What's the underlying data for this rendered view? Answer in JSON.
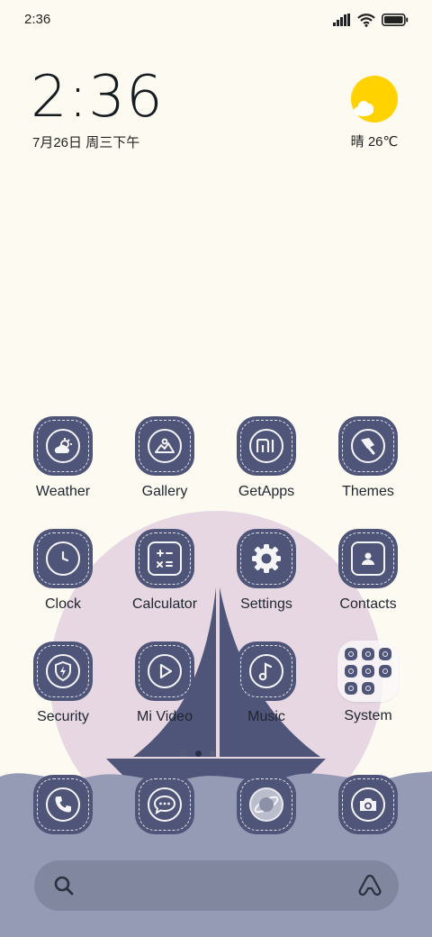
{
  "status_bar": {
    "time": "2:36"
  },
  "clock_widget": {
    "time": "2:36",
    "date": "7月26日 周三下午"
  },
  "weather_widget": {
    "condition": "晴",
    "temperature": "26℃"
  },
  "apps": [
    {
      "name": "weather",
      "label": "Weather"
    },
    {
      "name": "gallery",
      "label": "Gallery"
    },
    {
      "name": "getapps",
      "label": "GetApps"
    },
    {
      "name": "themes",
      "label": "Themes"
    },
    {
      "name": "clock",
      "label": "Clock"
    },
    {
      "name": "calculator",
      "label": "Calculator"
    },
    {
      "name": "settings",
      "label": "Settings"
    },
    {
      "name": "contacts",
      "label": "Contacts"
    },
    {
      "name": "security",
      "label": "Security"
    },
    {
      "name": "mi-video",
      "label": "Mi Video"
    },
    {
      "name": "music",
      "label": "Music"
    },
    {
      "name": "system",
      "label": "System"
    }
  ],
  "dock": [
    {
      "name": "phone",
      "icon": "phone-icon"
    },
    {
      "name": "messages",
      "icon": "message-bubble-icon"
    },
    {
      "name": "browser",
      "icon": "planet-icon"
    },
    {
      "name": "camera",
      "icon": "camera-icon"
    }
  ],
  "page_indicator": {
    "pages": 2,
    "current": 1
  },
  "colors": {
    "background": "#fdfbf1",
    "icon_tile": "#4f5578",
    "wallpaper_circle": "#e6d7e2",
    "sea": "#969bb5",
    "sun": "#ffd200"
  }
}
